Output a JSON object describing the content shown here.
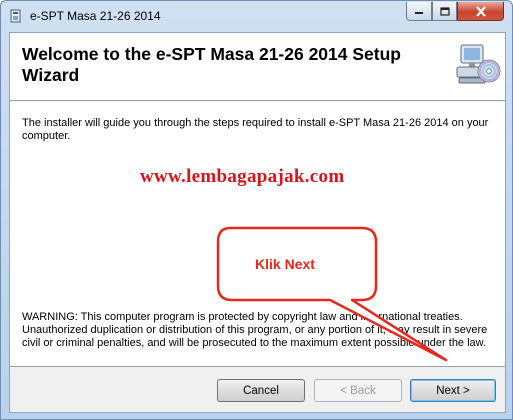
{
  "window": {
    "title": "e-SPT Masa 21-26 2014"
  },
  "banner": {
    "heading": "Welcome to the e-SPT Masa 21-26 2014 Setup Wizard",
    "icon": "computer-cd-icon"
  },
  "content": {
    "intro": "The installer will guide you through the steps required to install e-SPT Masa 21-26 2014 on your computer.",
    "website": "www.lembagapajak.com",
    "warning": "WARNING: This computer program is protected by copyright law and international treaties. Unauthorized duplication or distribution of this program, or any portion of it, may result in severe civil or criminal penalties, and will be prosecuted to the maximum extent possible under the law."
  },
  "buttons": {
    "cancel": "Cancel",
    "back": "< Back",
    "next": "Next >"
  },
  "annotation": {
    "callout_text": "Klik Next",
    "color": "#e8281e"
  }
}
